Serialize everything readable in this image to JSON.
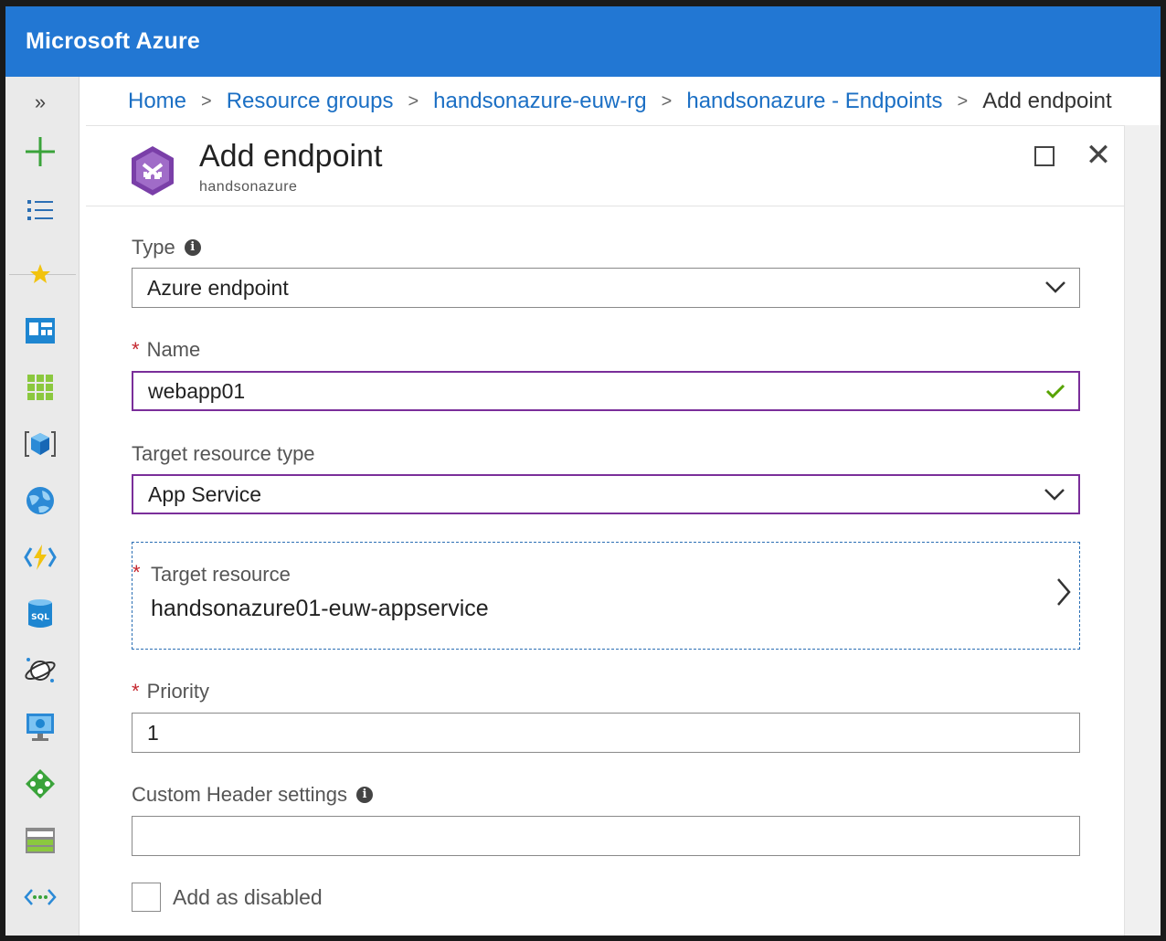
{
  "topbar": {
    "brand": "Microsoft Azure"
  },
  "leftnav": {
    "expand_glyph": "»",
    "icons": [
      "plus-icon",
      "all-services-list-icon",
      "favorites-star-icon",
      "dashboard-icon",
      "all-resources-grid-icon",
      "resource-groups-cube-icon",
      "app-services-globe-icon",
      "function-apps-lightning-icon",
      "sql-database-icon",
      "cosmos-db-planet-icon",
      "virtual-machines-monitor-icon",
      "load-balancer-icon",
      "storage-accounts-icon",
      "virtual-networks-icon"
    ]
  },
  "breadcrumb": {
    "items": [
      "Home",
      "Resource groups",
      "handsonazure-euw-rg",
      "handsonazure - Endpoints"
    ],
    "current": "Add endpoint",
    "separator": ">"
  },
  "panel": {
    "title": "Add endpoint",
    "subtitle": "handsonazure",
    "close_glyph": "✕"
  },
  "form": {
    "type_label": "Type",
    "type_value": "Azure endpoint",
    "name_label": "Name",
    "name_value": "webapp01",
    "target_type_label": "Target resource type",
    "target_type_value": "App Service",
    "target_label": "Target resource",
    "target_value": "handsonazure01-euw-appservice",
    "priority_label": "Priority",
    "priority_value": "1",
    "custom_header_label": "Custom Header settings",
    "custom_header_value": "",
    "disabled_label": "Add as disabled",
    "required_mark": "*",
    "info_glyph": "i"
  },
  "colors": {
    "topbar": "#2277d3",
    "link": "#1b6fc4",
    "required": "#c4262e",
    "focus_border": "#7a2e9a",
    "valid_check": "#57a300"
  }
}
